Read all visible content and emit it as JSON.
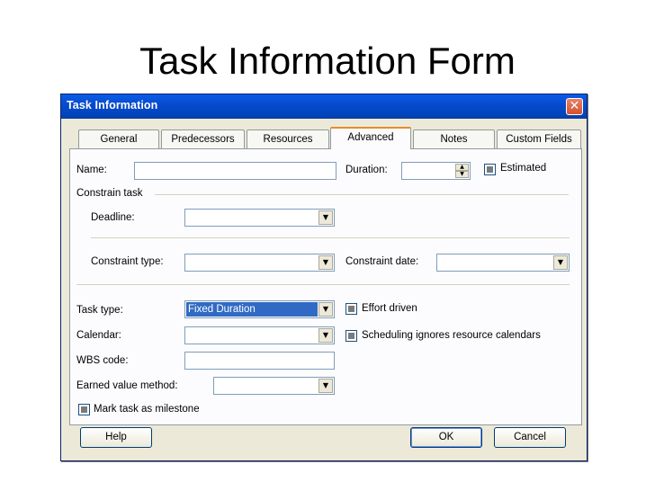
{
  "slide": {
    "title": "Task Information Form"
  },
  "dialog": {
    "title": "Task Information",
    "close_glyph": "✕",
    "tabs": [
      {
        "label": "General",
        "active": false
      },
      {
        "label": "Predecessors",
        "active": false
      },
      {
        "label": "Resources",
        "active": false
      },
      {
        "label": "Advanced",
        "active": true
      },
      {
        "label": "Notes",
        "active": false
      },
      {
        "label": "Custom Fields",
        "active": false
      }
    ],
    "fields": {
      "name_label": "Name:",
      "name_value": "",
      "duration_label": "Duration:",
      "duration_value": "",
      "estimated_label": "Estimated",
      "estimated_checked": true,
      "constrain_group": "Constrain task",
      "deadline_label": "Deadline:",
      "deadline_value": "",
      "constraint_type_label": "Constraint type:",
      "constraint_type_value": "",
      "constraint_date_label": "Constraint date:",
      "constraint_date_value": "",
      "task_type_label": "Task type:",
      "task_type_value": "Fixed Duration",
      "effort_driven_label": "Effort driven",
      "effort_driven_checked": true,
      "calendar_label": "Calendar:",
      "calendar_value": "",
      "scheduling_label": "Scheduling ignores resource calendars",
      "scheduling_checked": true,
      "wbs_label": "WBS code:",
      "wbs_value": "",
      "earned_value_label": "Earned value method:",
      "earned_value_value": "",
      "milestone_label": "Mark task as milestone",
      "milestone_checked": true
    },
    "buttons": {
      "help": "Help",
      "ok": "OK",
      "cancel": "Cancel"
    }
  },
  "colors": {
    "titlebar": "#0749c9",
    "dialog_bg": "#ece9d8",
    "selection": "#316ac5",
    "tab_highlight": "#e68b2c"
  }
}
